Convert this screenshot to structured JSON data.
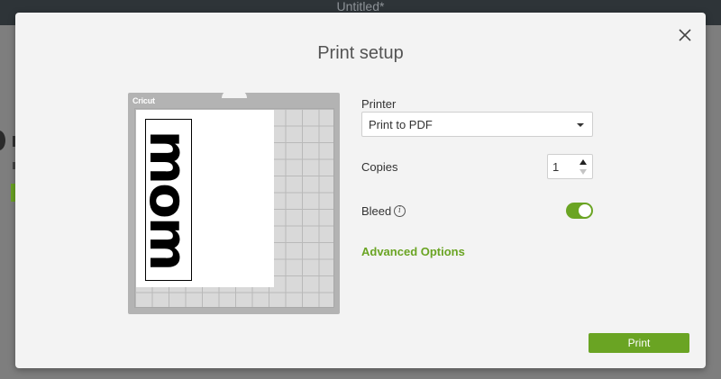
{
  "window": {
    "doc_title": "Untitled*"
  },
  "dialog": {
    "title": "Print setup",
    "mat": {
      "brand": "Cricut",
      "design_text": "mom"
    },
    "printer": {
      "label": "Printer",
      "selected": "Print to PDF"
    },
    "copies": {
      "label": "Copies",
      "value": "1"
    },
    "bleed": {
      "label": "Bleed",
      "enabled": true
    },
    "advanced_options": "Advanced Options",
    "print_button": "Print"
  },
  "colors": {
    "accent": "#6aa423",
    "topbar": "#2e3438",
    "dialog_bg": "#f3f3f3"
  },
  "icons": {
    "close": "close-icon",
    "info": "info-icon",
    "dropdown": "chevron-down-icon"
  }
}
